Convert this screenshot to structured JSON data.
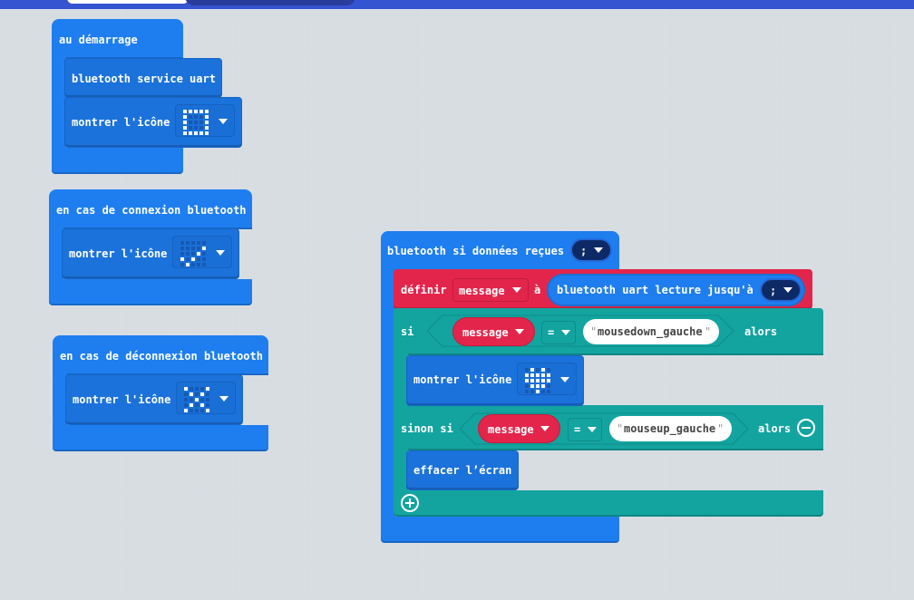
{
  "colors": {
    "basic_blue": "#1e7ef0",
    "variables_red": "#e3254b",
    "logic_teal": "#13a4a0",
    "workspace": "#eaeef1"
  },
  "block_on_start": {
    "hat_label": "au démarrage",
    "bluetooth_service_label": "bluetooth service uart",
    "show_icon_label": "montrer l'icône",
    "icon": "tall-rectangle-icon"
  },
  "block_on_connect": {
    "hat_label": "en cas de connexion bluetooth",
    "show_icon_label": "montrer l'icône",
    "icon": "yes-check-icon"
  },
  "block_on_disconnect": {
    "hat_label": "en cas de déconnexion bluetooth",
    "show_icon_label": "montrer l'icône",
    "icon": "no-x-icon"
  },
  "block_on_data": {
    "hat_label": "bluetooth si données reçues",
    "delimiter": ";",
    "set_label": "définir",
    "variable": "message",
    "to_label": "à",
    "read_until_label": "bluetooth uart lecture jusqu'à",
    "read_delimiter": ";",
    "if_label": "si",
    "if_variable": "message",
    "if_operator": "=",
    "if_string": "mousedown_gauche",
    "then_label": "alors",
    "if_show_icon_label": "montrer l'icône",
    "if_icon": "heart-icon",
    "elseif_label": "sinon si",
    "elseif_variable": "message",
    "elseif_operator": "=",
    "elseif_string": "mouseup_gauche",
    "elseif_then_label": "alors",
    "clear_screen_label": "effacer l’écran",
    "quote_open": "\"",
    "quote_close": "\""
  }
}
